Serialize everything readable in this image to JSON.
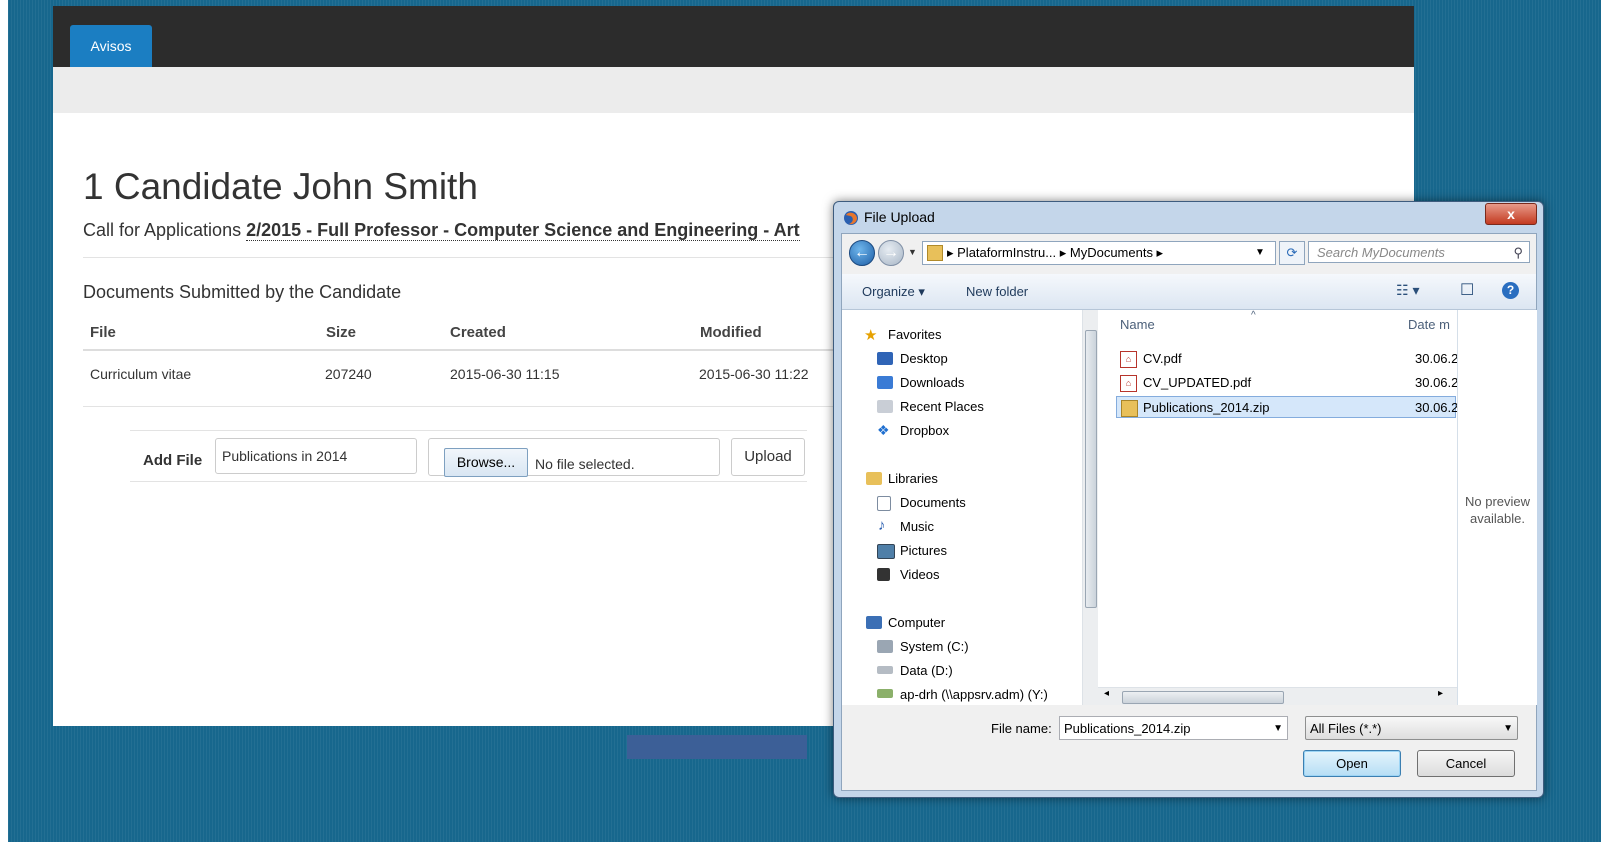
{
  "webpage": {
    "nav_tab": "Avisos",
    "title": "1 Candidate John Smith",
    "call_prefix": "Call for Applications",
    "call_value": "2/2015 - Full Professor - Computer Science and Engineering - Art",
    "docs_heading": "Documents Submitted by the Candidate",
    "table": {
      "headers": [
        "File",
        "Size",
        "Created",
        "Modified"
      ],
      "rows": [
        {
          "file": "Curriculum vitae",
          "size": "207240",
          "created": "2015-06-30 11:15",
          "modified": "2015-06-30 11:22"
        }
      ]
    },
    "add_file": {
      "label": "Add File",
      "description_value": "Publications in 2014",
      "browse_label": "Browse...",
      "no_file_text": "No file selected.",
      "upload_label": "Upload"
    }
  },
  "dialog": {
    "title": "File Upload",
    "close_symbol": "x",
    "breadcrumb": "▸ PlataformInstru... ▸ MyDocuments ▸",
    "search_placeholder": "Search MyDocuments",
    "toolbar": {
      "organize": "Organize ▾",
      "new_folder": "New folder"
    },
    "nav": {
      "favorites": "Favorites",
      "favorites_items": [
        "Desktop",
        "Downloads",
        "Recent Places",
        "Dropbox"
      ],
      "libraries": "Libraries",
      "libraries_items": [
        "Documents",
        "Music",
        "Pictures",
        "Videos"
      ],
      "computer": "Computer",
      "computer_items": [
        "System (C:)",
        "Data (D:)",
        "ap-drh (\\\\appsrv.adm) (Y:)"
      ]
    },
    "columns": {
      "name": "Name",
      "date": "Date m"
    },
    "files": [
      {
        "name": "CV.pdf",
        "date": "30.06.2"
      },
      {
        "name": "CV_UPDATED.pdf",
        "date": "30.06.2"
      },
      {
        "name": "Publications_2014.zip",
        "date": "30.06.2"
      }
    ],
    "preview_text": "No preview available.",
    "file_name_label": "File name:",
    "file_name_value": "Publications_2014.zip",
    "file_type_value": "All Files (*.*)",
    "open_label": "Open",
    "cancel_label": "Cancel"
  },
  "colors": {
    "background": "#17678d",
    "nav_dark": "#2c2c2c",
    "tab_active": "#1b7ec2",
    "selection": "#d5e7fa"
  }
}
